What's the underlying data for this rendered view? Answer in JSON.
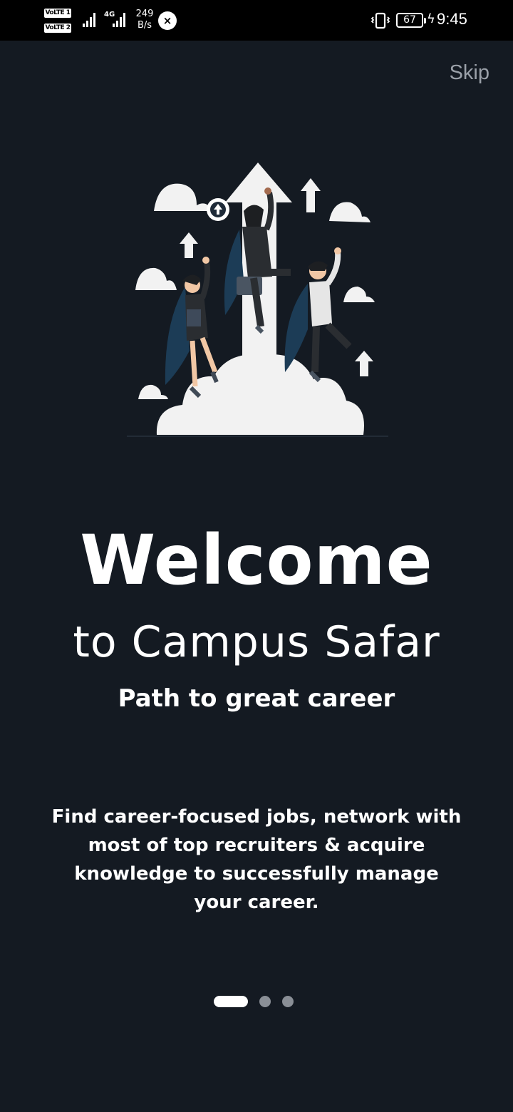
{
  "status_bar": {
    "volte1": "VoLTE 1",
    "volte2": "VoLTE 2",
    "network": "4G",
    "speed_value": "249",
    "speed_unit": "B/s",
    "battery": "67",
    "time": "9:45"
  },
  "skip_label": "Skip",
  "title": "Welcome",
  "subtitle": "to Campus Safar",
  "tagline": "Path to great career",
  "description": "Find career-focused jobs, network with most of top recruiters & acquire knowledge to successfully manage your career.",
  "pager": {
    "total": 3,
    "active": 0
  },
  "colors": {
    "background": "#141a22",
    "status_bar": "#000000",
    "skip": "#9aa0a8",
    "dot_inactive": "#8a8f96",
    "dot_active": "#ffffff"
  }
}
